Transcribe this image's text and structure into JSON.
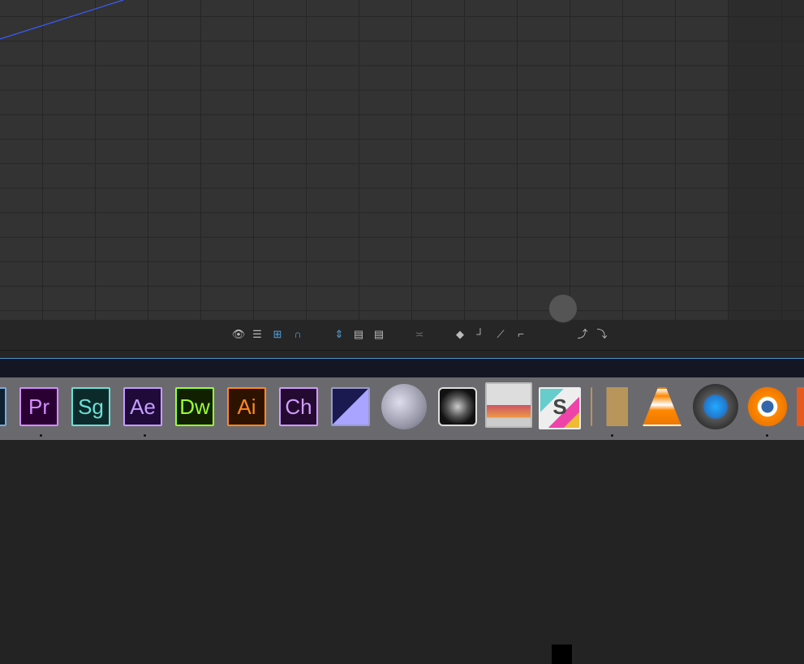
{
  "toolbar": {
    "icons": [
      "eye-icon",
      "list-icon",
      "transform-box-icon",
      "snap-magnet-icon",
      "fit-zoom-icon",
      "graph-fit-selection-icon",
      "graph-fit-all-icon",
      "separate-dimensions-icon",
      "keyframe-diamond-icon",
      "hold-keyframe-icon",
      "linear-keyframe-icon",
      "auto-bezier-icon",
      "easy-ease-icon",
      "easy-ease-in-icon",
      "easy-ease-out-icon"
    ]
  },
  "dock": {
    "apps": [
      {
        "name": "Premiere Pro",
        "label": "Pr",
        "color": "#d58cff",
        "bg": "#2a0033",
        "running": true
      },
      {
        "name": "SpeedGrade",
        "label": "Sg",
        "color": "#6ce0d8",
        "bg": "#0d2a2a",
        "running": false
      },
      {
        "name": "After Effects",
        "label": "Ae",
        "color": "#c69cff",
        "bg": "#1f0a3a",
        "running": true
      },
      {
        "name": "Dreamweaver",
        "label": "Dw",
        "color": "#9aff33",
        "bg": "#102000",
        "running": false
      },
      {
        "name": "Illustrator",
        "label": "Ai",
        "color": "#ff8a1e",
        "bg": "#2e1200",
        "running": false
      },
      {
        "name": "Character Animator",
        "label": "Ch",
        "color": "#d19bff",
        "bg": "#240a30",
        "running": false
      }
    ],
    "icons": [
      "media-encoder",
      "moon-app",
      "logic-pro",
      "preview",
      "slack",
      "garageband",
      "vlc",
      "quicktime",
      "blender"
    ],
    "running_icons": [
      "garageband",
      "blender"
    ]
  },
  "colors": {
    "accent": "#4ea3e0",
    "curve": "#3a5cff"
  }
}
